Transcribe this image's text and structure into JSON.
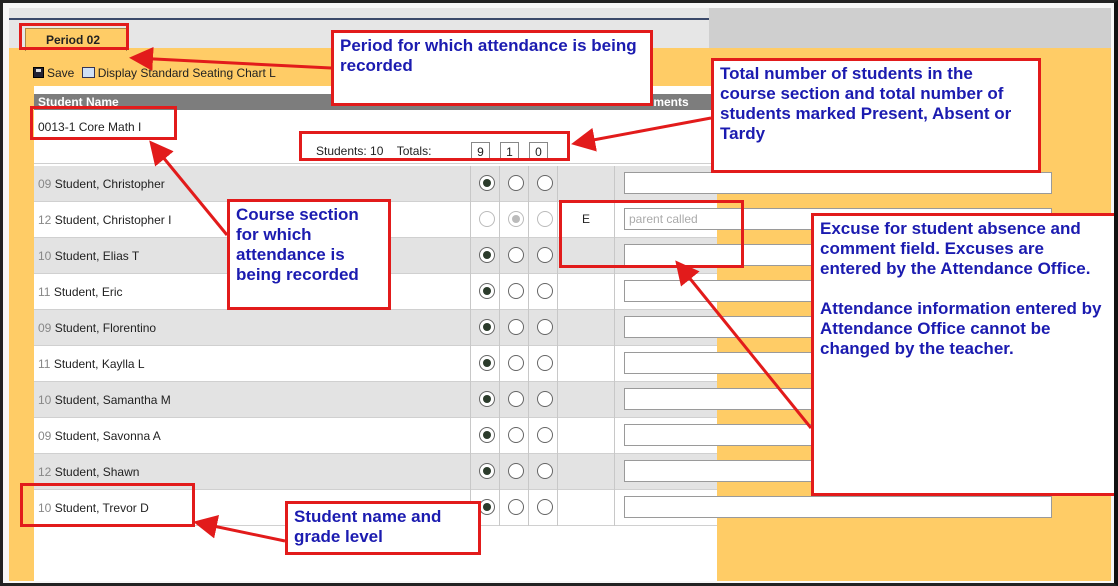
{
  "tab": {
    "label": "Period 02"
  },
  "toolbar": {
    "save_label": "Save",
    "seating_label": "Display Standard Seating Chart L"
  },
  "table": {
    "header_name": "Student Name",
    "header_comments": "nments",
    "course": "0013-1 Core Math I",
    "students_label": "Students: 10",
    "totals_label": "Totals:",
    "totals": [
      "9",
      "1",
      "0"
    ]
  },
  "students": [
    {
      "grade": "09",
      "name": "Student, Christopher",
      "present": true,
      "disabled": false,
      "excuse": "",
      "comment": ""
    },
    {
      "grade": "12",
      "name": "Student, Christopher I",
      "present": false,
      "disabled": true,
      "excuse": "E",
      "comment": "parent called"
    },
    {
      "grade": "10",
      "name": "Student, Elias T",
      "present": true,
      "disabled": false,
      "excuse": "",
      "comment": ""
    },
    {
      "grade": "11",
      "name": "Student, Eric",
      "present": true,
      "disabled": false,
      "excuse": "",
      "comment": ""
    },
    {
      "grade": "09",
      "name": "Student, Florentino",
      "present": true,
      "disabled": false,
      "excuse": "",
      "comment": ""
    },
    {
      "grade": "11",
      "name": "Student, Kaylla L",
      "present": true,
      "disabled": false,
      "excuse": "",
      "comment": ""
    },
    {
      "grade": "10",
      "name": "Student, Samantha M",
      "present": true,
      "disabled": false,
      "excuse": "",
      "comment": ""
    },
    {
      "grade": "09",
      "name": "Student, Savonna A",
      "present": true,
      "disabled": false,
      "excuse": "",
      "comment": ""
    },
    {
      "grade": "12",
      "name": "Student, Shawn",
      "present": true,
      "disabled": false,
      "excuse": "",
      "comment": ""
    },
    {
      "grade": "10",
      "name": "Student, Trevor D",
      "present": true,
      "disabled": false,
      "excuse": "",
      "comment": ""
    }
  ],
  "callouts": {
    "period": "Period for which attendance is being recorded",
    "totals": "Total number of students in the course section and total number of students marked Present, Absent or Tardy",
    "course_section": "Course section for which attendance is being recorded",
    "excuse_p1": "Excuse for student absence and comment field. Excuses are entered by the Attendance Office.",
    "excuse_p2": "Attendance information entered by Attendance Office cannot be changed by the teacher.",
    "student_name": "Student name and grade level"
  },
  "colors": {
    "accent": "#ffcc66",
    "callout_red": "#e21b1b",
    "callout_text": "#1b1bb0"
  }
}
